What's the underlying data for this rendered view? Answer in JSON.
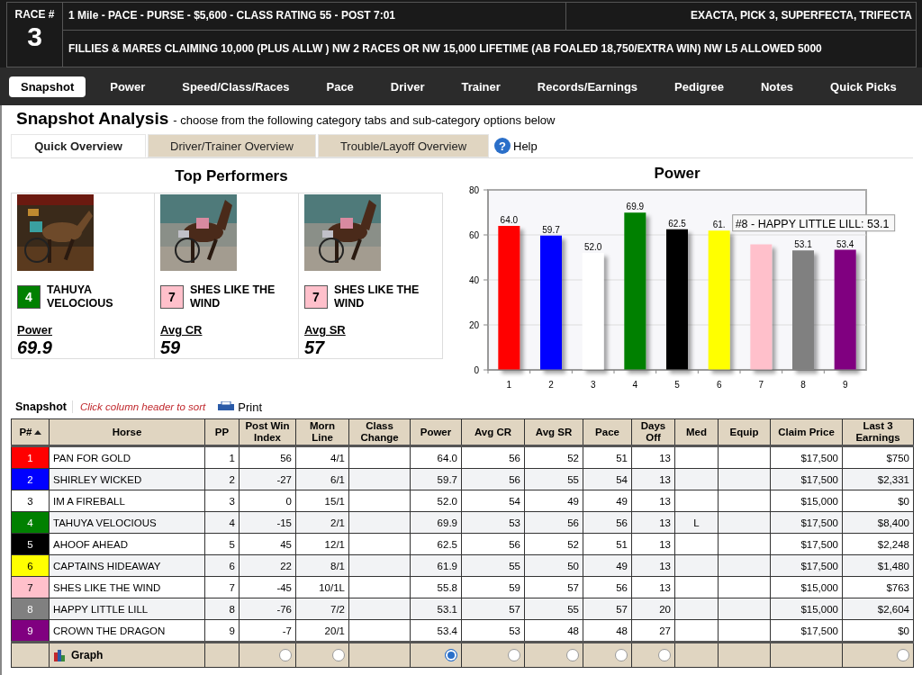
{
  "race_header": {
    "label": "RACE #",
    "number": "3",
    "conditions": "1 Mile - PACE - PURSE - $5,600 - CLASS RATING 55 - POST 7:01",
    "wagers": "EXACTA, PICK 3, SUPERFECTA, TRIFECTA",
    "description": "FILLIES & MARES CLAIMING 10,000 (PLUS ALLW ) NW 2 RACES OR NW 15,000 LIFETIME (AB FOALED 18,750/EXTRA WIN) NW L5 ALLOWED 5000"
  },
  "nav_tabs": [
    {
      "label": "Snapshot",
      "selected": true
    },
    {
      "label": "Power",
      "selected": false
    },
    {
      "label": "Speed/Class/Races",
      "selected": false
    },
    {
      "label": "Pace",
      "selected": false
    },
    {
      "label": "Driver",
      "selected": false
    },
    {
      "label": "Trainer",
      "selected": false
    },
    {
      "label": "Records/Earnings",
      "selected": false
    },
    {
      "label": "Pedigree",
      "selected": false
    },
    {
      "label": "Notes",
      "selected": false
    },
    {
      "label": "Quick Picks",
      "selected": false
    }
  ],
  "analysis": {
    "title": "Snapshot Analysis",
    "subtitle": "- choose from the following category tabs and sub-category options below",
    "tabs": [
      {
        "label": "Quick Overview",
        "selected": true
      },
      {
        "label": "Driver/Trainer Overview",
        "selected": false
      },
      {
        "label": "Trouble/Layoff Overview",
        "selected": false
      }
    ],
    "help_icon": "?",
    "help": "Help"
  },
  "top_performers": {
    "title": "Top Performers",
    "items": [
      {
        "kind": "picture",
        "number": "4",
        "color": "#008000",
        "horse": "TAHUYA VELOCIOUS",
        "metric": "Power",
        "value": "69.9"
      },
      {
        "kind": "picture",
        "number": "7",
        "color": "#ffc0cb",
        "horse": "SHES LIKE THE WIND",
        "metric": "Avg CR",
        "value": "59"
      },
      {
        "kind": "picture",
        "number": "7",
        "color": "#ffc0cb",
        "horse": "SHES LIKE THE WIND",
        "metric": "Avg SR",
        "value": "57"
      }
    ]
  },
  "power_chart": {
    "tooltip": "#8 - HAPPY LITTLE LILL: 53.1",
    "chart_data": {
      "type": "bar",
      "title": "Power",
      "categories": [
        "1",
        "2",
        "3",
        "4",
        "5",
        "6",
        "7",
        "8",
        "9"
      ],
      "series": [
        {
          "values": [
            64.0,
            59.7,
            52.0,
            69.9,
            62.5,
            61.9,
            55.8,
            53.1,
            53.4
          ]
        }
      ],
      "grid": true,
      "value_labels": [
        "64.0",
        "59.7",
        "52.0",
        "69.9",
        "62.5",
        "61.",
        null,
        "53.1",
        "53.4"
      ],
      "ylim": [
        0,
        80
      ],
      "yticks": [
        0,
        20,
        40,
        60,
        80
      ]
    }
  },
  "table": {
    "label": "Snapshot",
    "hint": "Click column header to sort",
    "print": "Print",
    "graph_label": "Graph",
    "columns": [
      {
        "label": "P#",
        "sorted": true
      },
      {
        "label": "Horse",
        "sorted": false
      },
      {
        "label": "PP",
        "sorted": false
      },
      {
        "label": "Post Win Index",
        "sorted": false,
        "graph": {
          "selected": false
        }
      },
      {
        "label": "Morn Line",
        "sorted": false,
        "graph": {
          "selected": false
        }
      },
      {
        "label": "Class Change",
        "sorted": false
      },
      {
        "label": "Power",
        "sorted": false,
        "graph": {
          "selected": true
        }
      },
      {
        "label": "Avg CR",
        "sorted": false,
        "graph": {
          "selected": false
        }
      },
      {
        "label": "Avg SR",
        "sorted": false,
        "graph": {
          "selected": false
        }
      },
      {
        "label": "Pace",
        "sorted": false,
        "graph": {
          "selected": false
        }
      },
      {
        "label": "Days Off",
        "sorted": false,
        "graph": {
          "selected": false
        }
      },
      {
        "label": "Med",
        "sorted": false
      },
      {
        "label": "Equip",
        "sorted": false
      },
      {
        "label": "Claim Price",
        "sorted": false
      },
      {
        "label": "Last 3 Earnings",
        "sorted": false,
        "graph": {
          "selected": false
        }
      }
    ],
    "rows": [
      {
        "number": "1",
        "color": "#ff0000",
        "horse": "PAN FOR GOLD",
        "pp": "1",
        "post_win_index": "56",
        "morn_line": "4/1",
        "power": "64.0",
        "avg_cr": "56",
        "avg_sr": "52",
        "pace": "51",
        "days_off": "13",
        "claim_price": "$17,500",
        "last_3_earnings": "$750"
      },
      {
        "number": "2",
        "color": "#0000ff",
        "horse": "SHIRLEY WICKED",
        "pp": "2",
        "post_win_index": "-27",
        "morn_line": "6/1",
        "power": "59.7",
        "avg_cr": "56",
        "avg_sr": "55",
        "pace": "54",
        "days_off": "13",
        "claim_price": "$17,500",
        "last_3_earnings": "$2,331"
      },
      {
        "number": "3",
        "color": "#ffffff",
        "horse": "IM A FIREBALL",
        "pp": "3",
        "post_win_index": "0",
        "morn_line": "15/1",
        "power": "52.0",
        "avg_cr": "54",
        "avg_sr": "49",
        "pace": "49",
        "days_off": "13",
        "claim_price": "$15,000",
        "last_3_earnings": "$0"
      },
      {
        "number": "4",
        "color": "#008000",
        "horse": "TAHUYA VELOCIOUS",
        "pp": "4",
        "post_win_index": "-15",
        "morn_line": "2/1",
        "power": "69.9",
        "avg_cr": "53",
        "avg_sr": "56",
        "pace": "56",
        "days_off": "13",
        "med": "L",
        "claim_price": "$17,500",
        "last_3_earnings": "$8,400"
      },
      {
        "number": "5",
        "color": "#000000",
        "horse": "AHOOF AHEAD",
        "pp": "5",
        "post_win_index": "45",
        "morn_line": "12/1",
        "power": "62.5",
        "avg_cr": "56",
        "avg_sr": "52",
        "pace": "51",
        "days_off": "13",
        "claim_price": "$17,500",
        "last_3_earnings": "$2,248"
      },
      {
        "number": "6",
        "color": "#ffff00",
        "horse": "CAPTAINS HIDEAWAY",
        "pp": "6",
        "post_win_index": "22",
        "morn_line": "8/1",
        "power": "61.9",
        "avg_cr": "55",
        "avg_sr": "50",
        "pace": "49",
        "days_off": "13",
        "claim_price": "$17,500",
        "last_3_earnings": "$1,480"
      },
      {
        "number": "7",
        "color": "#ffc0cb",
        "horse": "SHES LIKE THE WIND",
        "pp": "7",
        "post_win_index": "-45",
        "morn_line": "10/1L",
        "power": "55.8",
        "avg_cr": "59",
        "avg_sr": "57",
        "pace": "56",
        "days_off": "13",
        "claim_price": "$15,000",
        "last_3_earnings": "$763"
      },
      {
        "number": "8",
        "color": "#808080",
        "horse": "HAPPY LITTLE LILL",
        "pp": "8",
        "post_win_index": "-76",
        "morn_line": "7/2",
        "power": "53.1",
        "avg_cr": "57",
        "avg_sr": "55",
        "pace": "57",
        "days_off": "20",
        "claim_price": "$15,000",
        "last_3_earnings": "$2,604"
      },
      {
        "number": "9",
        "color": "#800080",
        "horse": "CROWN THE DRAGON",
        "pp": "9",
        "post_win_index": "-7",
        "morn_line": "20/1",
        "power": "53.4",
        "avg_cr": "53",
        "avg_sr": "48",
        "pace": "48",
        "days_off": "27",
        "claim_price": "$17,500",
        "last_3_earnings": "$0"
      }
    ]
  }
}
